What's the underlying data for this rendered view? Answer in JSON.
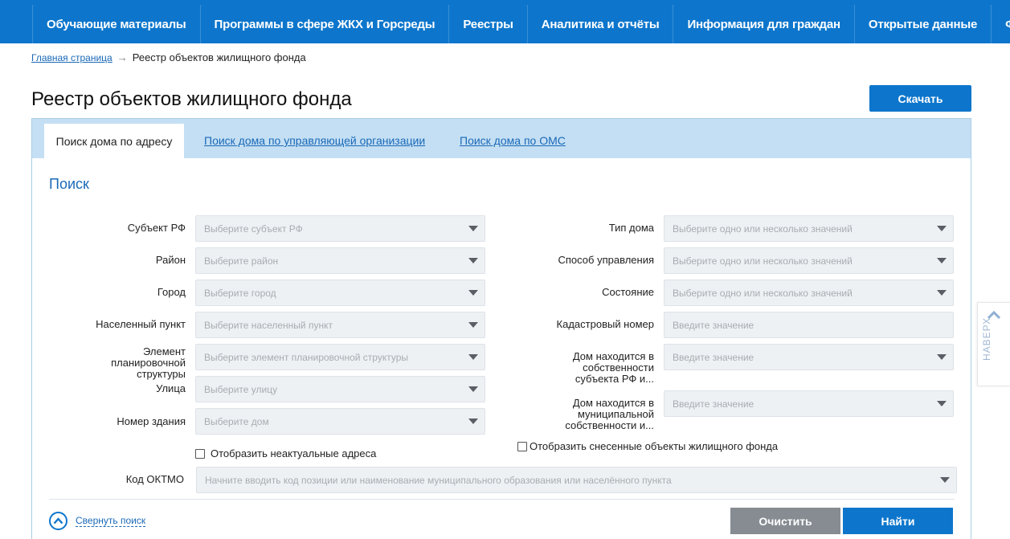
{
  "nav": {
    "items": [
      {
        "label": "Обучающие материалы"
      },
      {
        "label": "Программы в сфере ЖКХ и Горсреды"
      },
      {
        "label": "Реестры"
      },
      {
        "label": "Аналитика и отчёты"
      },
      {
        "label": "Информация для граждан"
      },
      {
        "label": "Открытые данные"
      },
      {
        "label": "Форум"
      }
    ]
  },
  "breadcrumb": {
    "home": "Главная страница",
    "arrow": "→",
    "current": "Реестр объектов жилищного фонда"
  },
  "header": {
    "title": "Реестр объектов жилищного фонда",
    "download_label": "Скачать"
  },
  "tabs": [
    {
      "label": "Поиск дома по адресу",
      "active": true
    },
    {
      "label": "Поиск дома по управляющей организации",
      "active": false
    },
    {
      "label": "Поиск дома по ОМС",
      "active": false
    }
  ],
  "search": {
    "title": "Поиск",
    "left_fields": [
      {
        "label": "Субъект РФ",
        "placeholder": "Выберите субъект РФ"
      },
      {
        "label": "Район",
        "placeholder": "Выберите район"
      },
      {
        "label": "Город",
        "placeholder": "Выберите город"
      },
      {
        "label": "Населенный пункт",
        "placeholder": "Выберите населенный пункт"
      },
      {
        "label": "Элемент планировочной структуры",
        "placeholder": "Выберите элемент планировочной структуры"
      },
      {
        "label": "Улица",
        "placeholder": "Выберите улицу"
      },
      {
        "label": "Номер здания",
        "placeholder": "Выберите дом"
      }
    ],
    "right_fields": [
      {
        "label": "Тип дома",
        "placeholder": "Выберите одно или несколько значений"
      },
      {
        "label": "Способ управления",
        "placeholder": "Выберите одно или несколько значений"
      },
      {
        "label": "Состояние",
        "placeholder": "Выберите одно или несколько значений"
      },
      {
        "label": "Кадастровый номер",
        "placeholder": "Введите значение"
      },
      {
        "label": "Дом находится в собственности субъекта РФ и...",
        "placeholder": "Введите значение"
      },
      {
        "label": "Дом находится в муниципальной собственности и...",
        "placeholder": "Введите значение"
      }
    ],
    "checkbox_inactual": "Отобразить неактуальные адреса",
    "checkbox_demolished": "Отобразить снесенные объекты жилищного фонда",
    "oktmo_label": "Код ОКТМО",
    "oktmo_placeholder": "Начните вводить код позиции или наименование муниципального образования или населённого пункта",
    "collapse_label": "Свернуть поиск",
    "clear_label": "Очистить",
    "find_label": "Найти"
  },
  "to_top": {
    "label": "НАВЕРХ"
  },
  "colors": {
    "brand": "#0d76cc",
    "tabs_bg": "#c4dff3",
    "field_bg": "#eef1f4",
    "clear_btn": "#868c92"
  }
}
